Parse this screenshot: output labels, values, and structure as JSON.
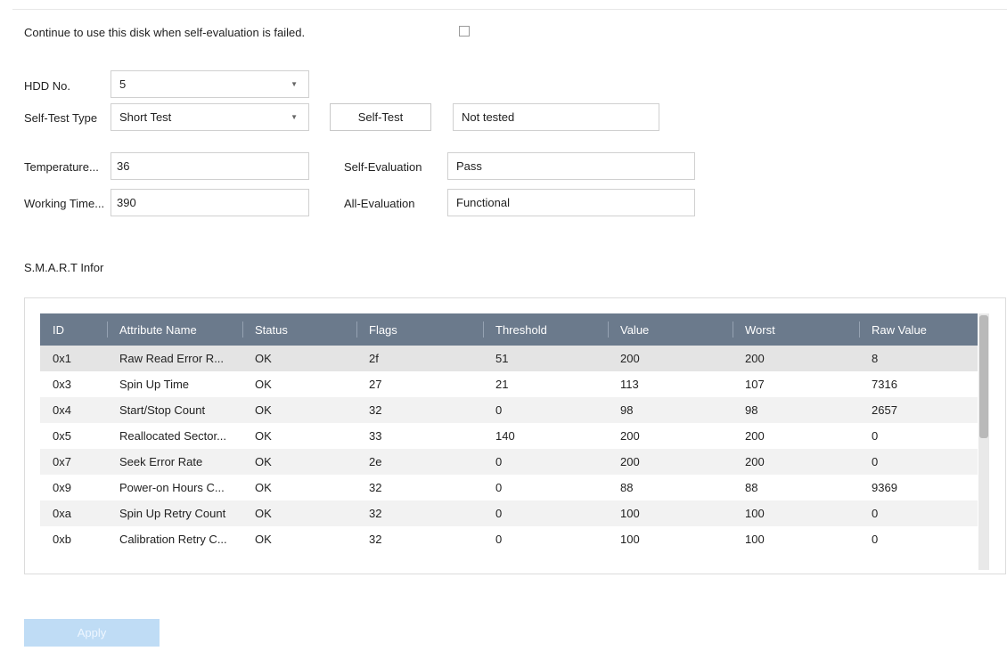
{
  "continue_label": "Continue to use this disk when self-evaluation is failed.",
  "hdd": {
    "label": "HDD No.",
    "value": "5"
  },
  "self_test_type": {
    "label": "Self-Test Type",
    "value": "Short Test"
  },
  "self_test_button": "Self-Test",
  "self_test_status": "Not tested",
  "temperature": {
    "label": "Temperature...",
    "value": "36"
  },
  "working_time": {
    "label": "Working Time...",
    "value": "390"
  },
  "self_evaluation": {
    "label": "Self-Evaluation",
    "value": "Pass"
  },
  "all_evaluation": {
    "label": "All-Evaluation",
    "value": "Functional"
  },
  "smart_title": "S.M.A.R.T Infor",
  "table": {
    "headers": [
      "ID",
      "Attribute Name",
      "Status",
      "Flags",
      "Threshold",
      "Value",
      "Worst",
      "Raw Value"
    ],
    "rows": [
      [
        "0x1",
        "Raw Read Error R...",
        "OK",
        "2f",
        "51",
        "200",
        "200",
        "8"
      ],
      [
        "0x3",
        "Spin Up Time",
        "OK",
        "27",
        "21",
        "113",
        "107",
        "7316"
      ],
      [
        "0x4",
        "Start/Stop Count",
        "OK",
        "32",
        "0",
        "98",
        "98",
        "2657"
      ],
      [
        "0x5",
        "Reallocated Sector...",
        "OK",
        "33",
        "140",
        "200",
        "200",
        "0"
      ],
      [
        "0x7",
        "Seek Error Rate",
        "OK",
        "2e",
        "0",
        "200",
        "200",
        "0"
      ],
      [
        "0x9",
        "Power-on Hours C...",
        "OK",
        "32",
        "0",
        "88",
        "88",
        "9369"
      ],
      [
        "0xa",
        "Spin Up Retry Count",
        "OK",
        "32",
        "0",
        "100",
        "100",
        "0"
      ],
      [
        "0xb",
        "Calibration Retry C...",
        "OK",
        "32",
        "0",
        "100",
        "100",
        "0"
      ]
    ]
  },
  "apply_button": "Apply",
  "colors": {
    "header": "#6b7a8c",
    "apply": "#bfdcf5",
    "selected_row": "#e4e4e4",
    "alt_row": "#f2f2f2"
  },
  "icons": {
    "select_caret": "chevron-down-icon"
  }
}
